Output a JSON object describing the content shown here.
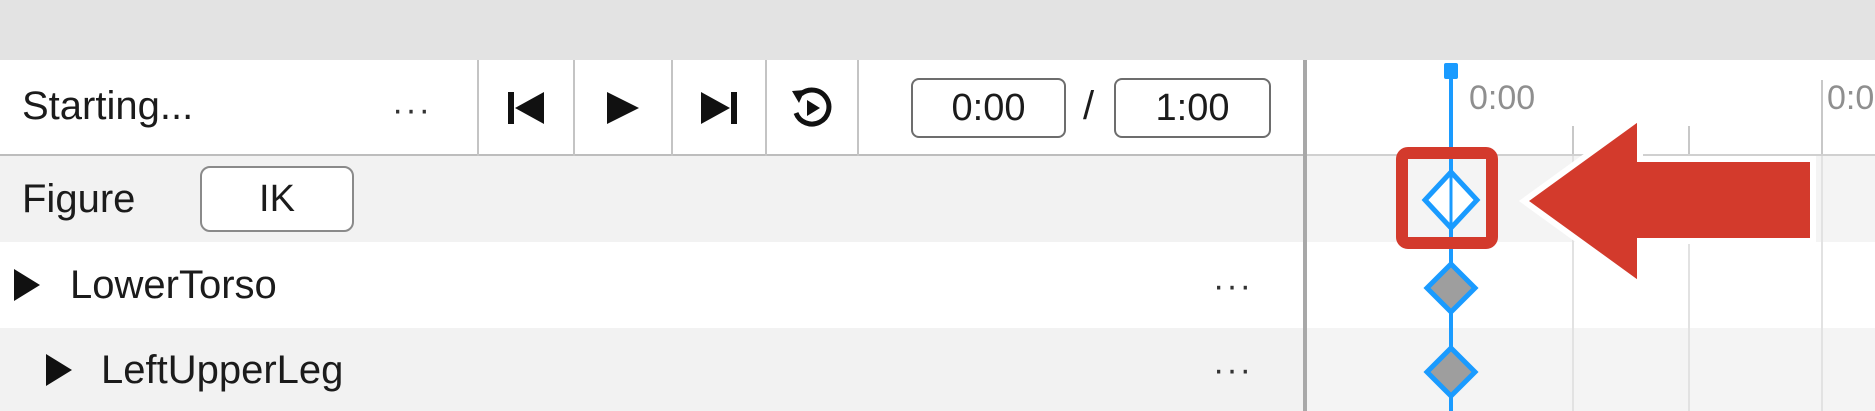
{
  "toolbar": {
    "animation_name": "Starting...",
    "more_label": "···",
    "current_time": "0:00",
    "separator": "/",
    "total_time": "1:00"
  },
  "tracks": {
    "figure": {
      "label": "Figure",
      "ik_label": "IK"
    },
    "items": [
      {
        "label": "LowerTorso",
        "more_label": "···"
      },
      {
        "label": "LeftUpperLeg",
        "more_label": "···"
      }
    ]
  },
  "timeline": {
    "tick_labels": [
      "0:00",
      "0:0"
    ],
    "playhead_color": "#1a9bff",
    "keyframe_color": "#1a9bff",
    "highlight_color": "#d33a2c"
  },
  "icons": {
    "skip_back": "skip-to-start-icon",
    "play": "play-icon",
    "skip_forward": "skip-to-end-icon",
    "loop": "loop-replay-icon",
    "expand": "triangle-right-icon",
    "keyframe": "diamond-keyframe-icon",
    "annotation": "red-arrow-pointer"
  }
}
